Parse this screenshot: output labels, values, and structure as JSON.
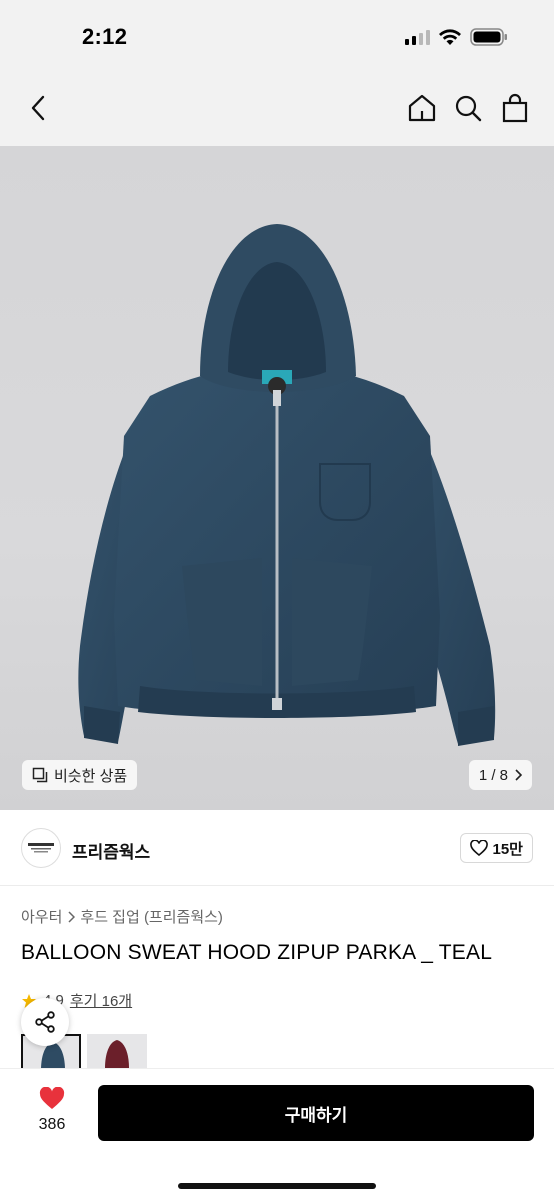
{
  "status_bar": {
    "time": "2:12"
  },
  "header": {
    "icons": [
      "back-icon",
      "home-icon",
      "search-icon",
      "shopping-bag-icon"
    ]
  },
  "image": {
    "similar_label": "비슷한 상품",
    "page_indicator": "1 / 8"
  },
  "brand": {
    "name": "프리즘웍스",
    "likes": "15만"
  },
  "product": {
    "breadcrumb": [
      "아우터",
      "후드 집업 (프리즘웍스)"
    ],
    "title": "BALLOON SWEAT HOOD ZIPUP PARKA _ TEAL",
    "rating": "4.9",
    "reviews_label": "후기 16개"
  },
  "bottom_bar": {
    "wish_count": "386",
    "buy_label": "구매하기"
  },
  "colors": {
    "accent": "#000000",
    "heart": "#e8323c",
    "star": "#f5b800",
    "garment": "#2e4b63",
    "alt_garment": "#6b1f2a"
  }
}
